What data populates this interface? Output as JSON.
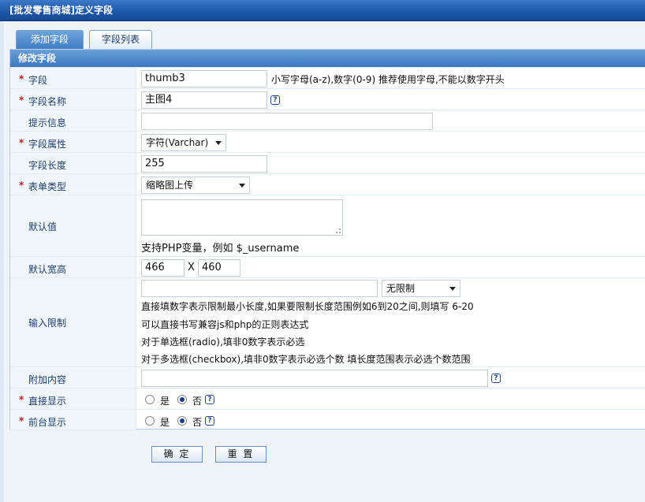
{
  "window": {
    "title": "[批发零售商城]定义字段"
  },
  "tabs": [
    {
      "label": "添加字段"
    },
    {
      "label": "字段列表"
    }
  ],
  "section": {
    "title": "修改字段"
  },
  "fields": {
    "field": {
      "label": "字段",
      "value": "thumb3",
      "hint": "小写字母(a-z),数字(0-9) 推荐使用字母,不能以数字开头"
    },
    "field_name": {
      "label": "字段名称",
      "value": "主图4"
    },
    "tip": {
      "label": "提示信息",
      "value": ""
    },
    "attr": {
      "label": "字段属性",
      "value": "字符(Varchar)"
    },
    "length": {
      "label": "字段长度",
      "value": "255"
    },
    "form_type": {
      "label": "表单类型",
      "value": "缩略图上传"
    },
    "default": {
      "label": "默认值",
      "value": "",
      "hint": "支持PHP变量，例如 $_username"
    },
    "size": {
      "label": "默认宽高",
      "width": "466",
      "sep": "X",
      "height": "460"
    },
    "limit": {
      "label": "输入限制",
      "value": "",
      "select": "无限制",
      "hints": [
        "直接填数字表示限制最小长度,如果要限制长度范围例如6到20之间,则填写 6-20",
        "可以直接书写兼容js和php的正则表达式",
        "对于单选框(radio),填非0数字表示必选",
        "对于多选框(checkbox),填非0数字表示必选个数 填长度范围表示必选个数范围"
      ]
    },
    "extra": {
      "label": "附加内容",
      "value": ""
    },
    "direct_show": {
      "label": "直接显示",
      "yes": "是",
      "no": "否",
      "selected": "否"
    },
    "front_show": {
      "label": "前台显示",
      "yes": "是",
      "no": "否",
      "selected": "否"
    }
  },
  "help_icon": "?",
  "buttons": {
    "submit": "确 定",
    "reset": "重 置"
  },
  "icons": {
    "help": "help-icon",
    "dropdown": "chevron-down-icon"
  },
  "colors": {
    "title_bar": "#1d56a6",
    "section_header": "#3d78c0",
    "required": "#d0161b",
    "label_bg": "#f1f6fc"
  }
}
